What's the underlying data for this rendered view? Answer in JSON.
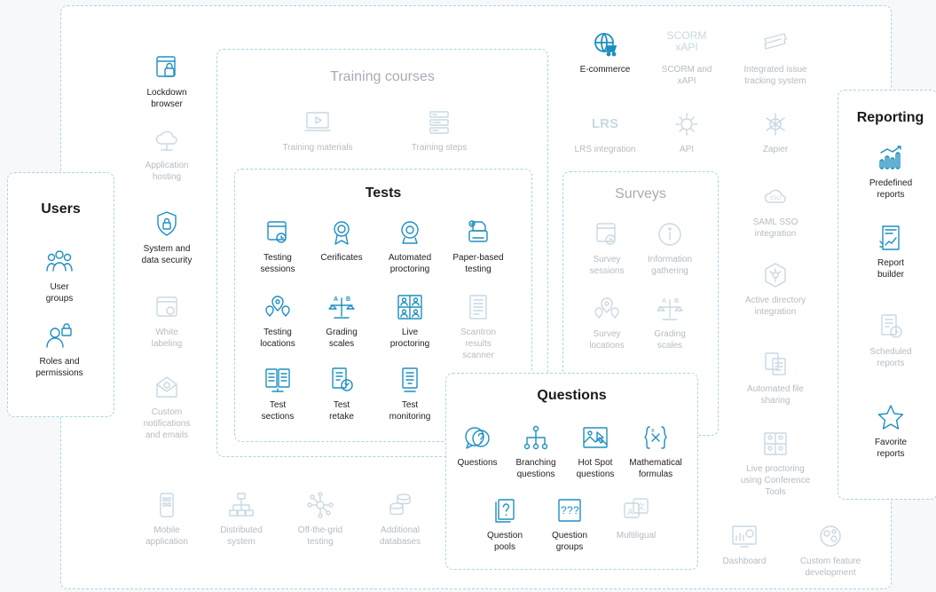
{
  "outer": {
    "items": [
      {
        "key": "lockdown",
        "label": "Lockdown\nbrowser",
        "icon": "lock-window-icon",
        "on": true
      },
      {
        "key": "hosting",
        "label": "Application\nhosting",
        "icon": "cloud-icon",
        "on": false
      },
      {
        "key": "security",
        "label": "System and\ndata security",
        "icon": "shield-lock-icon",
        "on": true
      },
      {
        "key": "white",
        "label": "White\nlabeling",
        "icon": "window-icon",
        "on": false
      },
      {
        "key": "notif",
        "label": "Custom\nnotifications\nand emails",
        "icon": "envelope-icon",
        "on": false
      },
      {
        "key": "mobile",
        "label": "Mobile\napplication",
        "icon": "mobile-icon",
        "on": false
      },
      {
        "key": "distributed",
        "label": "Distributed\nsystem",
        "icon": "network-icon",
        "on": false
      },
      {
        "key": "offgrid",
        "label": "Off-the-grid\ntesting",
        "icon": "hub-icon",
        "on": false
      },
      {
        "key": "databases",
        "label": "Additional\ndatabases",
        "icon": "database-icon",
        "on": false
      },
      {
        "key": "ecommerce",
        "label": "E-commerce",
        "icon": "globe-cart-icon",
        "on": true
      },
      {
        "key": "scorm",
        "label": "SCORM and\nxAPI",
        "icon": "scorm-text-icon",
        "on": false
      },
      {
        "key": "issue",
        "label": "Integrated issue\ntracking system",
        "icon": "ticket-icon",
        "on": false
      },
      {
        "key": "lrs",
        "label": "LRS integration",
        "icon": "lrs-text-icon",
        "on": false
      },
      {
        "key": "api",
        "label": "API",
        "icon": "api-gear-icon",
        "on": false
      },
      {
        "key": "zapier",
        "label": "Zapier",
        "icon": "asterisk-icon",
        "on": false
      },
      {
        "key": "saml",
        "label": "SAML SSO\nintegration",
        "icon": "sso-cloud-icon",
        "on": false
      },
      {
        "key": "ad",
        "label": "Active directory\nintegration",
        "icon": "hexagon-icon",
        "on": false
      },
      {
        "key": "filesharing",
        "label": "Automated file\nsharing",
        "icon": "documents-icon",
        "on": false
      },
      {
        "key": "conference",
        "label": "Live proctoring\nusing Conference Tools",
        "icon": "grid-people-icon",
        "on": false
      },
      {
        "key": "dashboard",
        "label": "Dashboard",
        "icon": "dashboard-icon",
        "on": false
      },
      {
        "key": "customdev",
        "label": "Custom feature\ndevelopment",
        "icon": "gears-icon",
        "on": false
      }
    ],
    "scorm_icon_text": "SCORM\nxAPI",
    "lrs_icon_text": "LRS"
  },
  "users": {
    "title": "Users",
    "items": [
      {
        "label": "User\ngroups",
        "icon": "users-group-icon"
      },
      {
        "label": "Roles and\npermissions",
        "icon": "user-lock-icon"
      }
    ]
  },
  "training": {
    "title": "Training courses",
    "items": [
      {
        "label": "Training materials",
        "icon": "monitor-play-icon"
      },
      {
        "label": "Training steps",
        "icon": "steps-icon"
      }
    ]
  },
  "tests": {
    "title": "Tests",
    "items": [
      {
        "label": "Testing\nsessions",
        "icon": "window-clock-icon",
        "on": true
      },
      {
        "label": "Cerificates",
        "icon": "ribbon-icon",
        "on": true
      },
      {
        "label": "Automated\nproctoring",
        "icon": "webcam-icon",
        "on": true
      },
      {
        "label": "Paper-based\ntesting",
        "icon": "printer-icon",
        "on": true
      },
      {
        "label": "Testing\nlocations",
        "icon": "map-pins-icon",
        "on": true
      },
      {
        "label": "Grading\nscales",
        "icon": "scale-ab-icon",
        "on": true
      },
      {
        "label": "Live\nproctoring",
        "icon": "video-grid-icon",
        "on": true
      },
      {
        "label": "Scantron\nresults\nscanner",
        "icon": "scantron-icon",
        "on": false
      },
      {
        "label": "Test\nsections",
        "icon": "book-sections-icon",
        "on": true
      },
      {
        "label": "Test\nretake",
        "icon": "retake-icon",
        "on": true
      },
      {
        "label": "Test\nmonitoring",
        "icon": "doc-monitor-icon",
        "on": true
      }
    ]
  },
  "surveys": {
    "title": "Surveys",
    "items": [
      {
        "label": "Survey\nsessions",
        "icon": "window-clock-icon"
      },
      {
        "label": "Information\ngathering",
        "icon": "info-icon"
      },
      {
        "label": "Survey\nlocations",
        "icon": "map-pins-icon"
      },
      {
        "label": "Grading\nscales",
        "icon": "scale-ab-icon"
      }
    ]
  },
  "questions": {
    "title": "Questions",
    "items": [
      {
        "label": "Questions",
        "icon": "speech-question-icon",
        "on": true
      },
      {
        "label": "Branching\nquestions",
        "icon": "branch-icon",
        "on": true
      },
      {
        "label": "Hot Spot\nquestions",
        "icon": "hotspot-image-icon",
        "on": true
      },
      {
        "label": "Mathematical\nformulas",
        "icon": "formula-icon",
        "on": true
      },
      {
        "label": "Question\npools",
        "icon": "question-pool-icon",
        "on": true
      },
      {
        "label": "Question\ngroups",
        "icon": "question-group-icon",
        "on": true
      },
      {
        "label": "Multiligual",
        "icon": "translate-icon",
        "on": false
      }
    ]
  },
  "reporting": {
    "title": "Reporting",
    "items": [
      {
        "label": "Predefined\nreports",
        "icon": "bar-chart-icon",
        "on": true
      },
      {
        "label": "Report\nbuilder",
        "icon": "report-chart-icon",
        "on": true
      },
      {
        "label": "Scheduled\nreports",
        "icon": "report-clock-icon",
        "on": false
      },
      {
        "label": "Favorite\nreports",
        "icon": "star-icon",
        "on": true
      }
    ]
  },
  "colors": {
    "accent": "#1e8fc0",
    "faded_icon": "#c8d8e3",
    "border": "#a9d3e6"
  }
}
